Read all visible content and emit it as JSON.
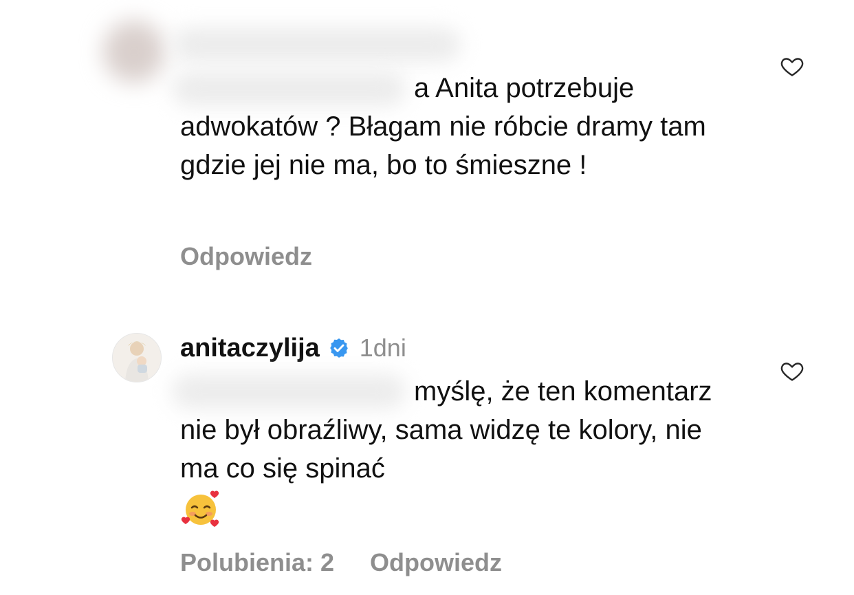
{
  "comments": [
    {
      "text_line_1": "a Anita potrzebuje",
      "text_rest": "adwokatów ? Błagam nie róbcie dramy tam gdzie jej nie ma, bo to śmieszne !",
      "reply_label": "Odpowiedz",
      "like_icon": "heart-outline-icon"
    },
    {
      "username": "anitaczylija",
      "verified_icon": "verified-badge-icon",
      "timestamp": "1dni",
      "text_line_1": "myślę, że ten",
      "text_rest": "komentarz nie był obraźliwy, sama widzę te kolory, nie ma co się spinać",
      "emoji_icon": "smiling-face-with-hearts-icon",
      "likes_label": "Polubienia: 2",
      "reply_label": "Odpowiedz",
      "like_icon": "heart-outline-icon"
    }
  ],
  "colors": {
    "text": "#111111",
    "secondary": "#8e8e8e",
    "verified": "#3897f0"
  }
}
